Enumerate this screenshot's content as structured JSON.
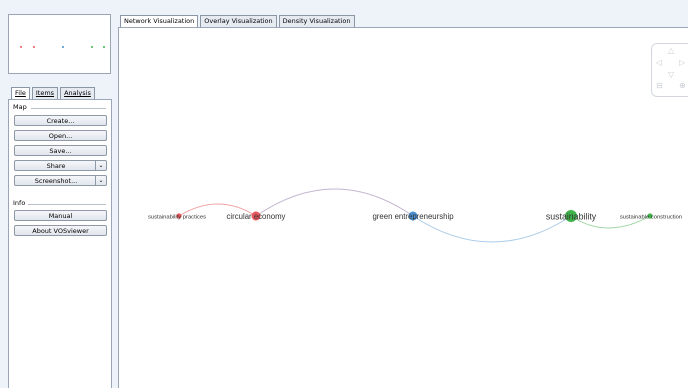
{
  "left_tabs": [
    {
      "label": "File",
      "active": true
    },
    {
      "label": "Items",
      "active": false
    },
    {
      "label": "Analysis",
      "active": false
    }
  ],
  "map_group": {
    "title": "Map",
    "buttons": [
      "Create...",
      "Open...",
      "Save...",
      "Share",
      "Screenshot..."
    ]
  },
  "info_group": {
    "title": "Info",
    "buttons": [
      "Manual",
      "About VOSviewer"
    ]
  },
  "main_tabs": [
    {
      "label": "Network Visualization",
      "active": true
    },
    {
      "label": "Overlay Visualization",
      "active": false
    },
    {
      "label": "Density Visualization",
      "active": false
    }
  ],
  "network": {
    "nodes": [
      {
        "label": "sustainability practices",
        "cluster": "red"
      },
      {
        "label": "circular economy",
        "cluster": "red"
      },
      {
        "label": "green entrepreneurship",
        "cluster": "blue"
      },
      {
        "label": "sustainability",
        "cluster": "green"
      },
      {
        "label": "sustainable construction",
        "cluster": "green"
      }
    ],
    "cluster_colors": {
      "red": "#e8585c",
      "blue": "#4a8fd0",
      "green": "#3fb24a"
    },
    "link_colors": {
      "red": "#f2a3a5",
      "blue": "#a9cbe8",
      "green": "#9ed6a3"
    }
  },
  "nav_icons": [
    "up-arrow-icon",
    "left-arrow-icon",
    "right-arrow-icon",
    "down-arrow-icon",
    "zoom-out-icon",
    "zoom-in-icon"
  ]
}
